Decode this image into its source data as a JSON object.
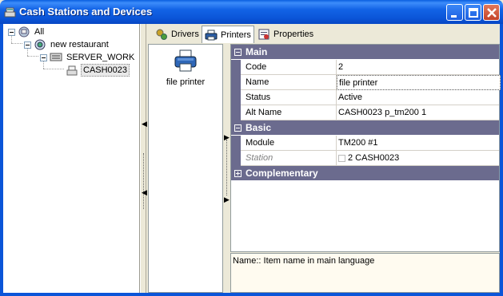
{
  "window": {
    "title": "Cash Stations and Devices"
  },
  "tree": {
    "items": [
      {
        "label": "All"
      },
      {
        "label": "new restaurant"
      },
      {
        "label": "SERVER_WORK"
      },
      {
        "label": "CASH0023"
      }
    ]
  },
  "tabs": [
    {
      "label": "Drivers"
    },
    {
      "label": "Printers"
    },
    {
      "label": "Properties"
    }
  ],
  "printers": {
    "items": [
      {
        "label": "file printer"
      }
    ]
  },
  "properties": {
    "categories": [
      {
        "label": "Main",
        "rows": [
          {
            "name": "Code",
            "value": "2"
          },
          {
            "name": "Name",
            "value": "file printer"
          },
          {
            "name": "Status",
            "value": "Active"
          },
          {
            "name": "Alt Name",
            "value": "CASH0023 p_tm200 1"
          }
        ]
      },
      {
        "label": "Basic",
        "rows": [
          {
            "name": "Module",
            "value": "TM200 #1"
          },
          {
            "name": "Station",
            "value": "2 CASH0023"
          }
        ]
      },
      {
        "label": "Complementary",
        "rows": []
      }
    ]
  },
  "description": {
    "text": "Name:: Item name in main language"
  }
}
